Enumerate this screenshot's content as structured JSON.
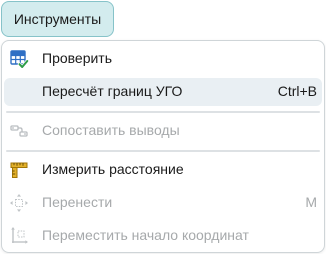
{
  "menu_button": {
    "label": "Инструменты"
  },
  "menu": {
    "items": [
      {
        "label": "Проверить",
        "icon": "table-check-icon",
        "shortcut": "",
        "enabled": true
      },
      {
        "label": "Пересчёт границ УГО",
        "icon": "",
        "shortcut": "Ctrl+B",
        "enabled": true,
        "highlighted": true
      },
      {
        "label": "Сопоставить выводы",
        "icon": "link-pins-icon",
        "shortcut": "",
        "enabled": false
      },
      {
        "label": "Измерить расстояние",
        "icon": "ruler-measure-icon",
        "shortcut": "",
        "enabled": true
      },
      {
        "label": "Перенести",
        "icon": "move-arrows-icon",
        "shortcut": "M",
        "enabled": false
      },
      {
        "label": "Переместить начало координат",
        "icon": "move-origin-icon",
        "shortcut": "",
        "enabled": false
      }
    ]
  },
  "colors": {
    "button_bg": "#d3ecee",
    "button_border": "#86c3c9",
    "highlight_bg": "#e9eff3",
    "disabled_text": "#a6a9ab",
    "icon_blue": "#2f6fc4",
    "icon_green": "#2e9c48",
    "icon_gold": "#c99a10"
  }
}
